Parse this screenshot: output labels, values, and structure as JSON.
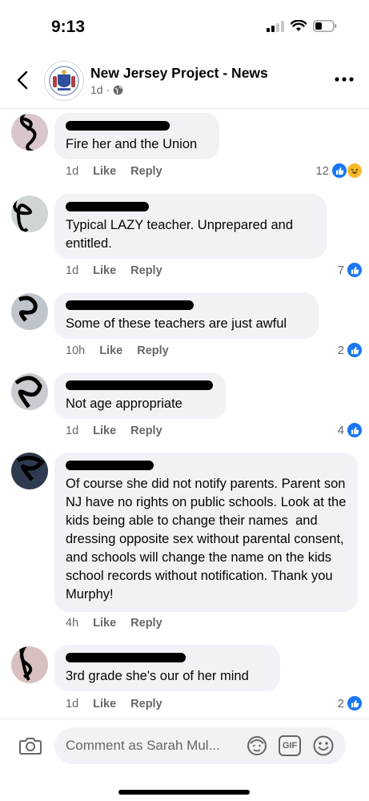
{
  "status_bar": {
    "time": "9:13"
  },
  "header": {
    "title": "New Jersey Project - News",
    "time_ago": "1d",
    "separator": "·"
  },
  "comments": [
    {
      "text": "Fire her and the Union",
      "time": "1d",
      "like": "Like",
      "reply": "Reply",
      "reaction_count": "12",
      "reactions": [
        "like",
        "haha"
      ]
    },
    {
      "text": "Typical LAZY teacher. Unprepared and entitled.",
      "time": "1d",
      "like": "Like",
      "reply": "Reply",
      "reaction_count": "7",
      "reactions": [
        "like"
      ]
    },
    {
      "text": "Some of these teachers are just awful",
      "time": "10h",
      "like": "Like",
      "reply": "Reply",
      "reaction_count": "2",
      "reactions": [
        "like"
      ]
    },
    {
      "text": "Not age appropriate",
      "time": "1d",
      "like": "Like",
      "reply": "Reply",
      "reaction_count": "4",
      "reactions": [
        "like"
      ]
    },
    {
      "text": "Of course she did not notify parents. Parent son NJ have no rights on public schools. Look at the kids being able to change their names  and dressing opposite sex without parental consent, and schools will change the name on the kids school records without notification. Thank you Murphy!",
      "time": "4h",
      "like": "Like",
      "reply": "Reply",
      "reaction_count": "",
      "reactions": []
    },
    {
      "text": "3rd grade she's our of her mind",
      "time": "1d",
      "like": "Like",
      "reply": "Reply",
      "reaction_count": "2",
      "reactions": [
        "like"
      ]
    }
  ],
  "composer": {
    "placeholder": "Comment as Sarah Mul...",
    "gif_label": "GIF"
  },
  "colors": {
    "accent": "#1877f2",
    "bubble": "#f0f2f5",
    "muted": "#65676b"
  }
}
